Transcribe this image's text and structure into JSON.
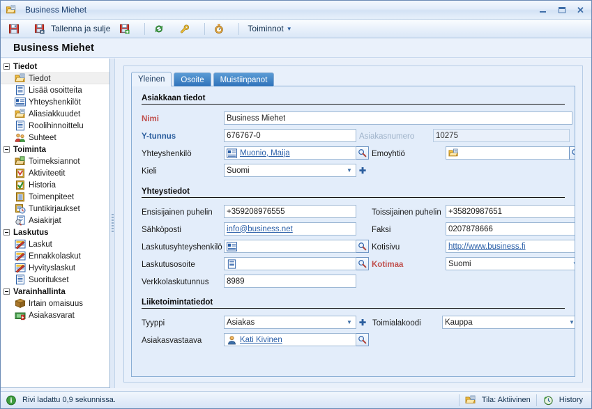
{
  "window": {
    "title": "Business Miehet",
    "controls": {
      "minimize": "Minimize",
      "maximize": "Maximize",
      "close": "Close"
    }
  },
  "toolbar": {
    "save_label": "",
    "save_close_label": "Tallenna ja sulje",
    "new_label": "",
    "refresh_label": "",
    "tools_label": "",
    "timer_label": "",
    "actions_label": "Toiminnot"
  },
  "page": {
    "heading": "Business Miehet"
  },
  "sidebar": {
    "groups": [
      {
        "label": "Tiedot",
        "items": [
          {
            "label": "Tiedot",
            "icon": "folder-open-icon",
            "selected": true
          },
          {
            "label": "Lisää osoitteita",
            "icon": "document-icon",
            "selected": false
          },
          {
            "label": "Yhteyshenkilöt",
            "icon": "contact-card-icon",
            "selected": false
          },
          {
            "label": "Aliasiakkuudet",
            "icon": "folder-open-icon",
            "selected": false
          },
          {
            "label": "Roolihinnoittelu",
            "icon": "document-icon",
            "selected": false
          },
          {
            "label": "Suhteet",
            "icon": "people-icon",
            "selected": false
          }
        ]
      },
      {
        "label": "Toiminta",
        "items": [
          {
            "label": "Toimeksiannot",
            "icon": "folder-tasks-icon",
            "selected": false
          },
          {
            "label": "Aktiviteetit",
            "icon": "clipboard-check-icon",
            "selected": false
          },
          {
            "label": "Historia",
            "icon": "clipboard-done-icon",
            "selected": false
          },
          {
            "label": "Toimenpiteet",
            "icon": "clipboard-list-icon",
            "selected": false
          },
          {
            "label": "Tuntikirjaukset",
            "icon": "clipboard-clock-icon",
            "selected": false
          },
          {
            "label": "Asiakirjat",
            "icon": "document-search-icon",
            "selected": false
          }
        ]
      },
      {
        "label": "Laskutus",
        "items": [
          {
            "label": "Laskut",
            "icon": "invoice-icon",
            "selected": false
          },
          {
            "label": "Ennakkolaskut",
            "icon": "invoice-icon",
            "selected": false
          },
          {
            "label": "Hyvityslaskut",
            "icon": "invoice-icon",
            "selected": false
          },
          {
            "label": "Suoritukset",
            "icon": "document-icon",
            "selected": false
          }
        ]
      },
      {
        "label": "Varainhallinta",
        "items": [
          {
            "label": "Irtain omaisuus",
            "icon": "box-icon",
            "selected": false
          },
          {
            "label": "Asiakasvarat",
            "icon": "money-icon",
            "selected": false
          }
        ]
      }
    ]
  },
  "tabs": [
    {
      "label": "Yleinen",
      "active": true
    },
    {
      "label": "Osoite",
      "active": false
    },
    {
      "label": "Muistiinpanot",
      "active": false
    }
  ],
  "form": {
    "sections": [
      {
        "title": "Asiakkaan tiedot"
      },
      {
        "title": "Yhteystiedot"
      },
      {
        "title": "Liiketoimintatiedot"
      }
    ],
    "customer": {
      "nimi_label": "Nimi",
      "nimi_value": "Business Miehet",
      "ytunnus_label": "Y-tunnus",
      "ytunnus_value": "676767-0",
      "asiakasnumero_label": "Asiakasnumero",
      "asiakasnumero_value": "10275",
      "yhteyshenkilo_label": "Yhteyshenkilö",
      "yhteyshenkilo_value": "Muonio, Maija",
      "emoyhtio_label": "Emoyhtiö",
      "emoyhtio_value": "",
      "kieli_label": "Kieli",
      "kieli_value": "Suomi"
    },
    "contact": {
      "ensisijainen_label": "Ensisijainen puhelin",
      "ensisijainen_value": "+359208976555",
      "toissijainen_label": "Toissijainen puhelin",
      "toissijainen_value": "+35820987651",
      "sahkoposti_label": "Sähköposti",
      "sahkoposti_value": "info@business.net",
      "faksi_label": "Faksi",
      "faksi_value": "0207878666",
      "laskutusyhteyshenkilo_label": "Laskutusyhteyshenkilö",
      "laskutusyhteyshenkilo_value": "",
      "kotisivu_label": "Kotisivu",
      "kotisivu_value": "http://www.business.fi",
      "laskutusosoite_label": "Laskutusosoite",
      "laskutusosoite_value": "",
      "kotimaa_label": "Kotimaa",
      "kotimaa_value": "Suomi",
      "verkkolasku_label": "Verkkolaskutunnus",
      "verkkolasku_value": "8989"
    },
    "business": {
      "tyyppi_label": "Tyyppi",
      "tyyppi_value": "Asiakas",
      "toimialakoodi_label": "Toimialakoodi",
      "toimialakoodi_value": "Kauppa",
      "asiakasvastaava_label": "Asiakasvastaava",
      "asiakasvastaava_value": "Kati Kivinen"
    }
  },
  "status": {
    "message": "Rivi ladattu 0,9 sekunnissa.",
    "state": "Tila: Aktiivinen",
    "history": "History"
  },
  "colors": {
    "required": "#c0504d",
    "label_blue": "#2b5e9e",
    "link": "#2a5fa8",
    "tab_active_bg": "#eaf2fc",
    "tab_inactive_bg": "#2f73ba",
    "panel_bg": "#e3edfa"
  }
}
